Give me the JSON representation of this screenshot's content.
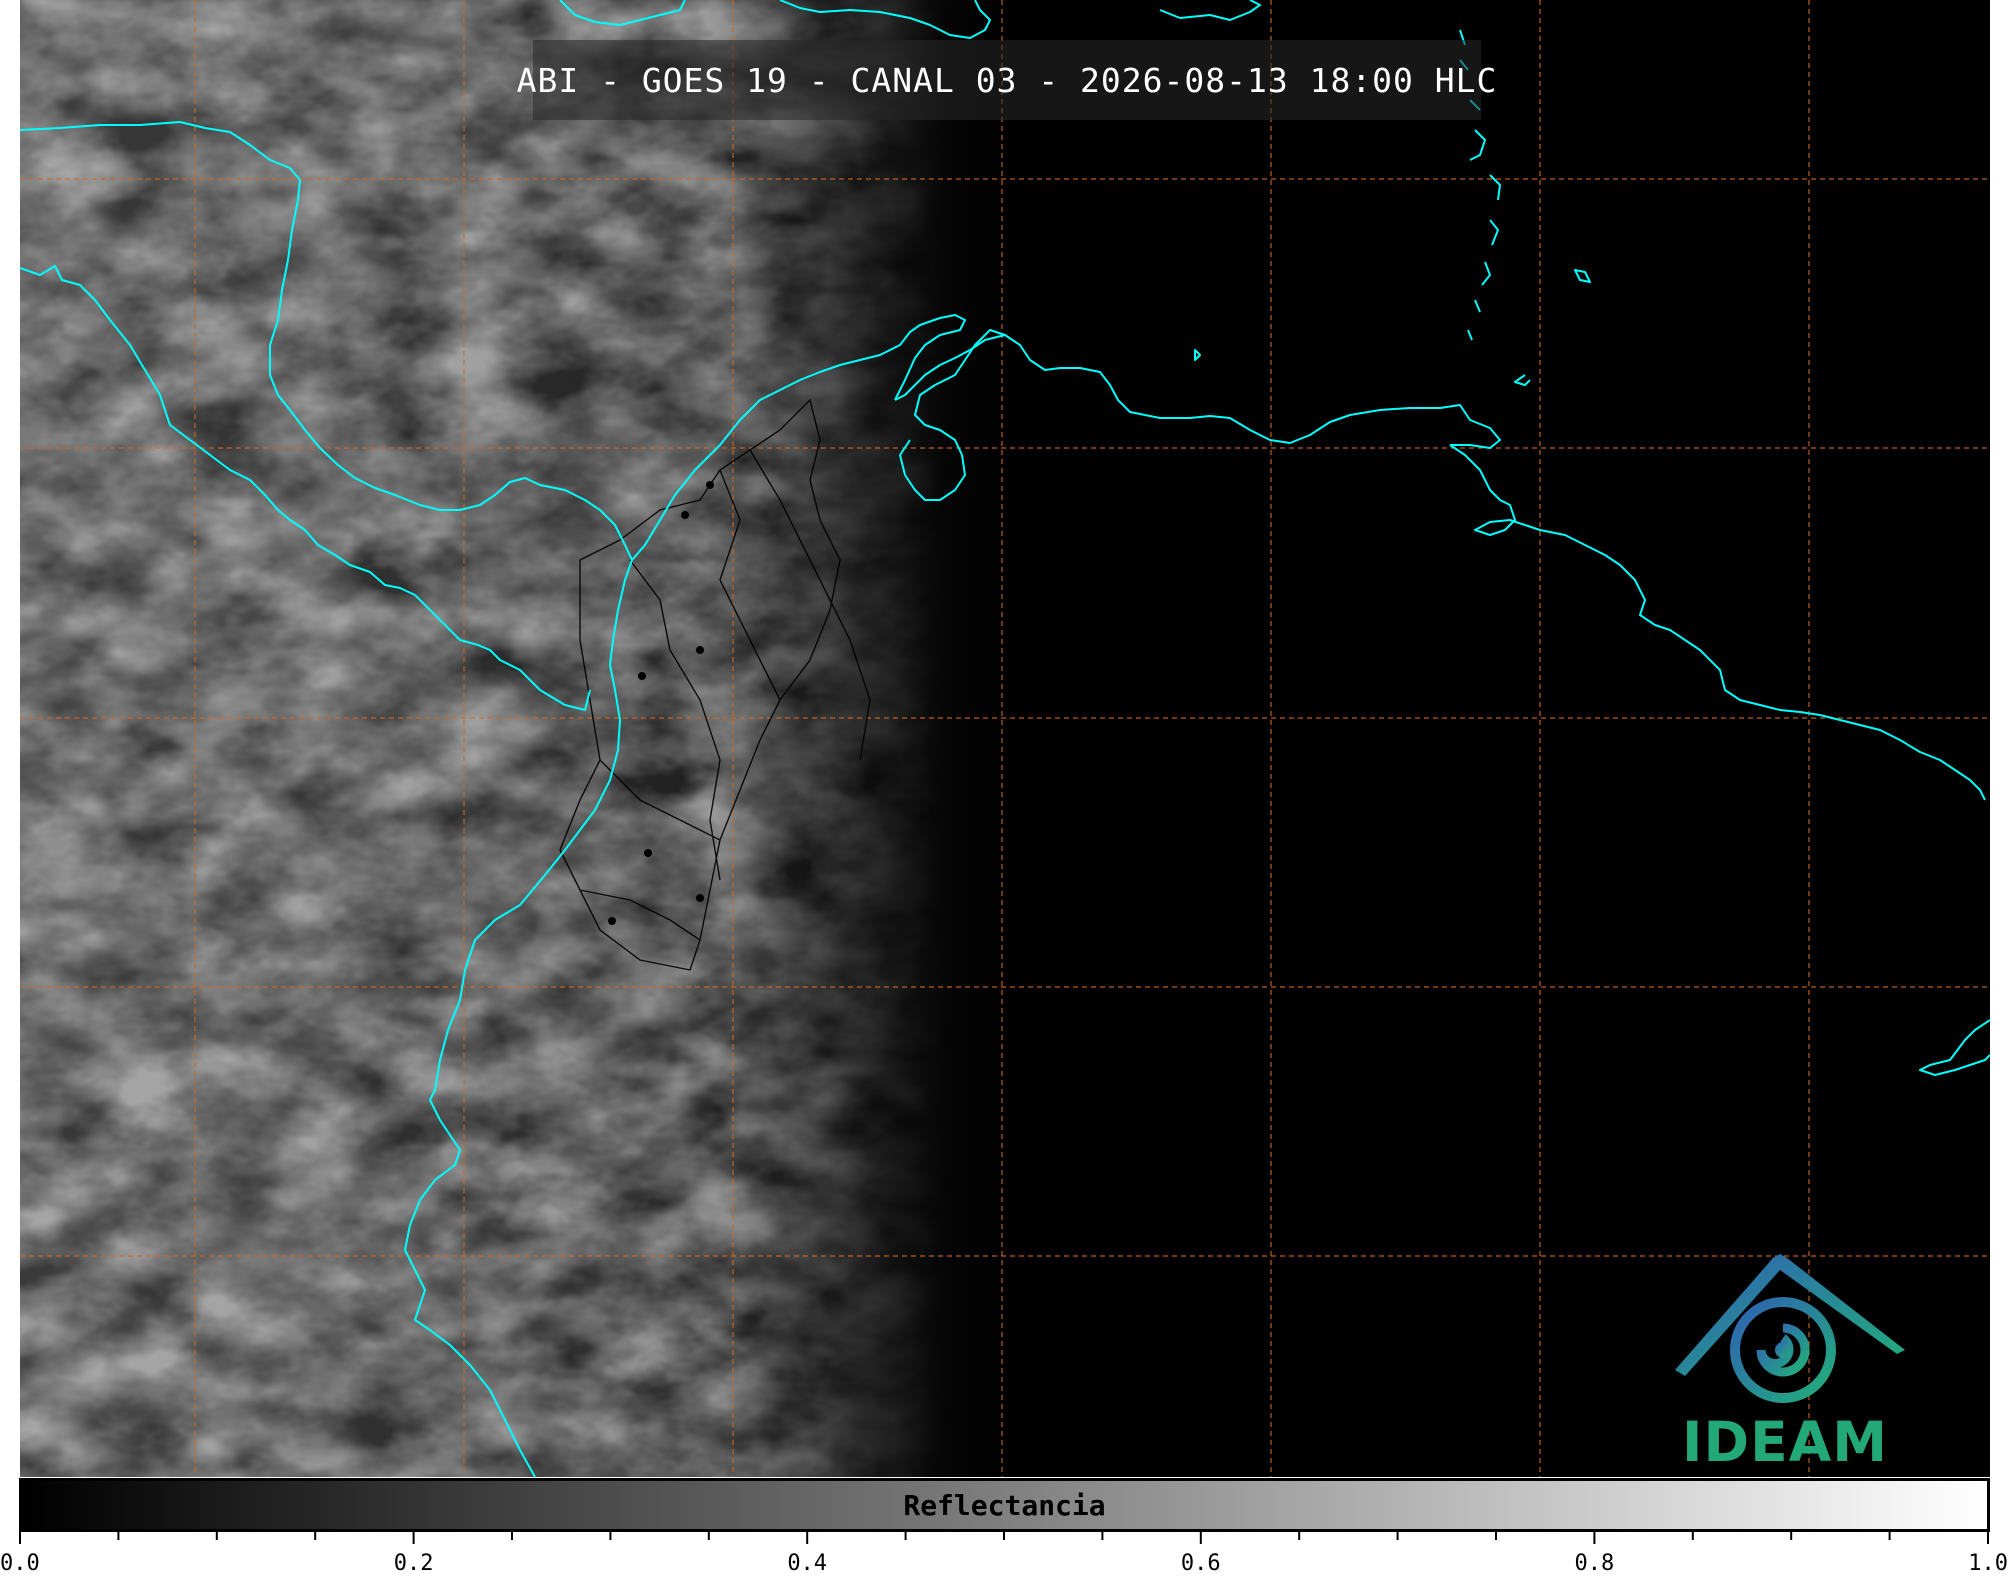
{
  "title": "ABI - GOES 19 - CANAL 03 - 2026-08-13 18:00 HLC",
  "colorbar": {
    "label": "Reflectancia",
    "min": 0.0,
    "max": 1.0,
    "major_ticks": [
      "0.0",
      "0.2",
      "0.4",
      "0.6",
      "0.8",
      "1.0"
    ],
    "minor_step": 0.05,
    "colormap": "grayscale"
  },
  "logo": {
    "text": "IDEAM"
  },
  "map": {
    "gridline_color": "#d2691e",
    "coastline_color": "#00ffff",
    "border_color": "#000000",
    "background": "#000000"
  }
}
